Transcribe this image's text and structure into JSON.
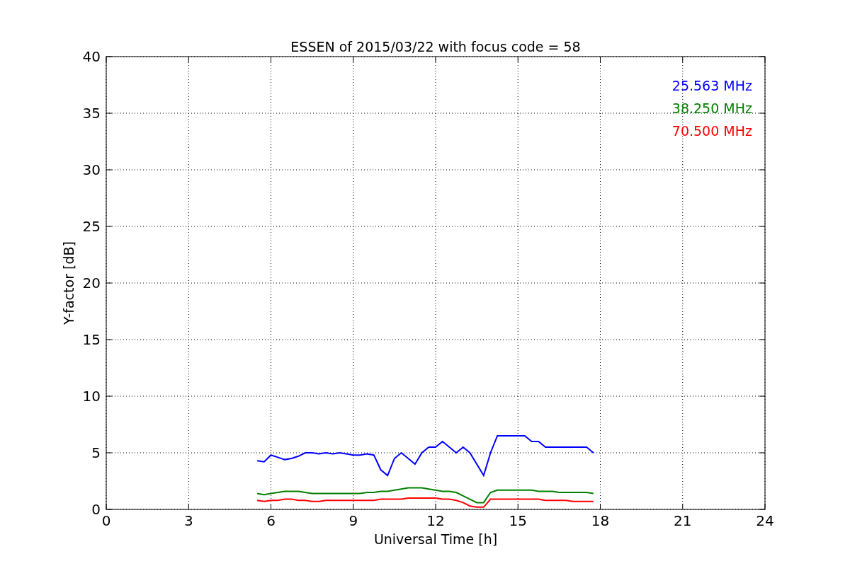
{
  "chart_data": {
    "type": "line",
    "title": "ESSEN of 2015/03/22 with focus code = 58",
    "xlabel": "Universal Time [h]",
    "ylabel": "Y-factor [dB]",
    "x": [
      5.5,
      5.75,
      6,
      6.25,
      6.5,
      6.75,
      7,
      7.25,
      7.5,
      7.75,
      8,
      8.25,
      8.5,
      8.75,
      9,
      9.25,
      9.5,
      9.75,
      10,
      10.25,
      10.5,
      10.75,
      11,
      11.25,
      11.5,
      11.75,
      12,
      12.25,
      12.5,
      12.75,
      13,
      13.25,
      13.5,
      13.75,
      14,
      14.25,
      14.5,
      14.75,
      15,
      15.25,
      15.5,
      15.75,
      16,
      16.25,
      16.5,
      16.75,
      17,
      17.25,
      17.5,
      17.75
    ],
    "series": [
      {
        "name": "25.563 MHz",
        "color": "#0000ff",
        "values": [
          4.3,
          4.2,
          4.8,
          4.6,
          4.4,
          4.5,
          4.7,
          5.0,
          5.0,
          4.9,
          5.0,
          4.9,
          5.0,
          4.9,
          4.8,
          4.8,
          4.9,
          4.8,
          3.5,
          3.0,
          4.5,
          5.0,
          4.5,
          4.0,
          5.0,
          5.5,
          5.5,
          6.0,
          5.5,
          5.0,
          5.5,
          5.0,
          4.0,
          3.0,
          5.0,
          6.5,
          6.5,
          6.5,
          6.5,
          6.5,
          6.0,
          6.0,
          5.5,
          5.5,
          5.5,
          5.5,
          5.5,
          5.5,
          5.5,
          5.0
        ]
      },
      {
        "name": "38.250 MHz",
        "color": "#008000",
        "values": [
          1.4,
          1.3,
          1.4,
          1.5,
          1.6,
          1.6,
          1.6,
          1.5,
          1.4,
          1.4,
          1.4,
          1.4,
          1.4,
          1.4,
          1.4,
          1.4,
          1.5,
          1.5,
          1.6,
          1.6,
          1.7,
          1.8,
          1.9,
          1.9,
          1.9,
          1.8,
          1.7,
          1.6,
          1.6,
          1.5,
          1.2,
          0.9,
          0.6,
          0.6,
          1.5,
          1.7,
          1.7,
          1.7,
          1.7,
          1.7,
          1.7,
          1.6,
          1.6,
          1.6,
          1.5,
          1.5,
          1.5,
          1.5,
          1.5,
          1.4
        ]
      },
      {
        "name": "70.500 MHz",
        "color": "#ff0000",
        "values": [
          0.8,
          0.7,
          0.8,
          0.8,
          0.9,
          0.9,
          0.8,
          0.8,
          0.7,
          0.7,
          0.8,
          0.8,
          0.8,
          0.8,
          0.8,
          0.8,
          0.8,
          0.8,
          0.9,
          0.9,
          0.9,
          0.9,
          1.0,
          1.0,
          1.0,
          1.0,
          1.0,
          0.9,
          0.9,
          0.8,
          0.6,
          0.3,
          0.2,
          0.2,
          0.9,
          0.9,
          0.9,
          0.9,
          0.9,
          0.9,
          0.9,
          0.9,
          0.8,
          0.8,
          0.8,
          0.8,
          0.7,
          0.7,
          0.7,
          0.7
        ]
      }
    ],
    "xlim": [
      0,
      24
    ],
    "ylim": [
      0,
      40
    ],
    "grid": true,
    "xticks": [
      0,
      3,
      6,
      9,
      12,
      15,
      18,
      21,
      24
    ],
    "yticks": [
      0,
      5,
      10,
      15,
      20,
      25,
      30,
      35,
      40
    ]
  }
}
